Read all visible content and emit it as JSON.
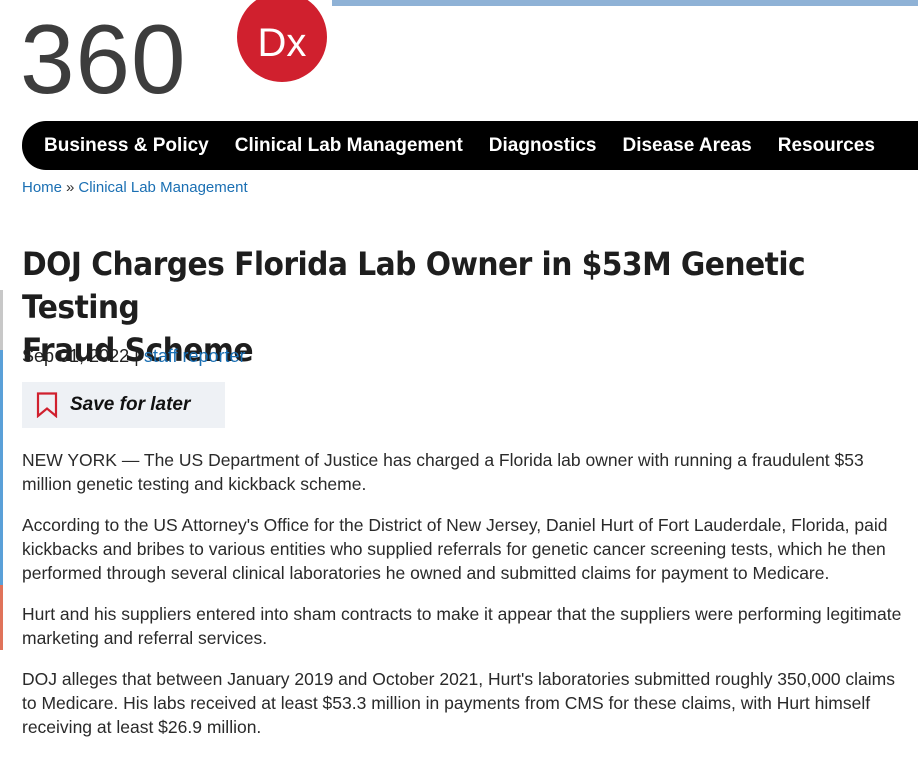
{
  "logo": {
    "number": "360",
    "badge": "Dx"
  },
  "nav": {
    "items": [
      "Business & Policy",
      "Clinical Lab Management",
      "Diagnostics",
      "Disease Areas",
      "Resources"
    ]
  },
  "breadcrumb": {
    "home": "Home",
    "separator": "»",
    "section": "Clinical Lab Management"
  },
  "article": {
    "title_line1": "DOJ Charges Florida Lab Owner in $53M Genetic Testing",
    "title_line2": "Fraud Scheme",
    "date": "Sep 01, 2022",
    "divider": "|",
    "author": "staff reporter",
    "save_label": "Save for later",
    "paragraphs": [
      "NEW YORK — The US Department of Justice has charged a Florida lab owner with running a fraudulent $53 million genetic testing and kickback scheme.",
      "According to the US Attorney's Office for the District of New Jersey, Daniel Hurt of Fort Lauderdale, Florida, paid kickbacks and bribes to various entities who supplied referrals for genetic cancer screening tests, which he then performed through several clinical laboratories he owned and submitted claims for payment to Medicare.",
      "Hurt and his suppliers entered into sham contracts to make it appear that the suppliers were performing legitimate marketing and referral services.",
      "DOJ alleges that between January 2019 and October 2021, Hurt's laboratories submitted roughly 350,000 claims to Medicare. His labs received at least $53.3 million in payments from CMS for these claims, with Hurt himself receiving at least $26.9 million."
    ]
  },
  "colors": {
    "brand_red": "#d0202e",
    "link_blue": "#1a6fb3",
    "nav_bg": "#000000"
  }
}
